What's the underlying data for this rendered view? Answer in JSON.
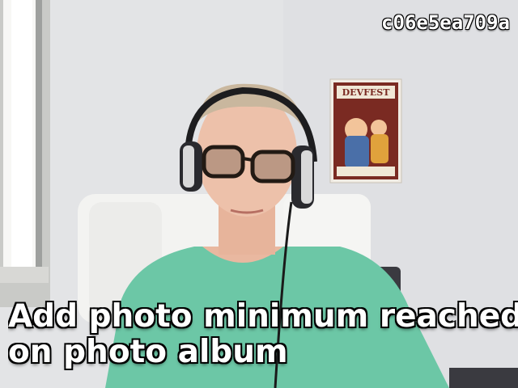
{
  "overlay": {
    "id_text": "c06e5ea709a"
  },
  "caption": {
    "line1": "Add photo minimum reached ale",
    "line2": "on photo album"
  },
  "poster": {
    "title": "DEVFEST"
  },
  "colors": {
    "wall": "#e3e4e6",
    "shirt": "#6cc7a6",
    "chair": "#f3f3f1",
    "skin": "#e9b8a0"
  }
}
